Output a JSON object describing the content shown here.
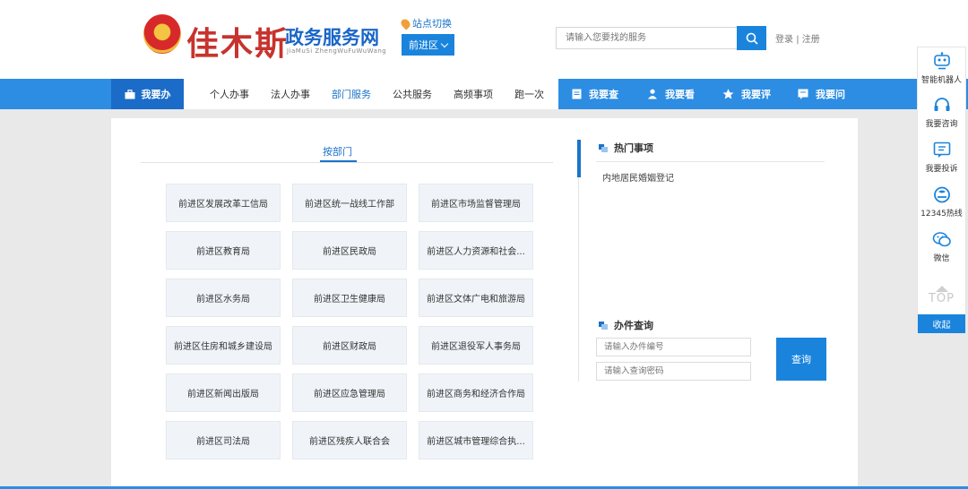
{
  "header": {
    "logo_text": "佳木斯",
    "site_title": "政务服务网",
    "pinyin": "JiaMuSi ZhengWuFuWuWang",
    "site_switch_label": "站点切换",
    "district": "前进区",
    "search_placeholder": "请输入您要找的服务",
    "login": "登录",
    "separator": "|",
    "register": "注册"
  },
  "nav": {
    "main": "我要办",
    "links": [
      "个人办事",
      "法人办事",
      "部门服务",
      "公共服务",
      "高频事项",
      "跑一次"
    ],
    "active_index": 2,
    "right": [
      "我要查",
      "我要看",
      "我要评",
      "我要问"
    ]
  },
  "departments": {
    "tab": "按部门",
    "items": [
      "前进区发展改革工信局",
      "前进区统一战线工作部",
      "前进区市场监督管理局",
      "前进区教育局",
      "前进区民政局",
      "前进区人力资源和社会...",
      "前进区水务局",
      "前进区卫生健康局",
      "前进区文体广电和旅游局",
      "前进区住房和城乡建设局",
      "前进区财政局",
      "前进区退役军人事务局",
      "前进区新闻出版局",
      "前进区应急管理局",
      "前进区商务和经济合作局",
      "前进区司法局",
      "前进区残疾人联合会",
      "前进区城市管理综合执..."
    ]
  },
  "hot": {
    "title": "热门事项",
    "items": [
      "内地居民婚姻登记"
    ]
  },
  "query": {
    "title": "办件查询",
    "number_placeholder": "请输入办件编号",
    "password_placeholder": "请输入查询密码",
    "button": "查询"
  },
  "float_bar": {
    "items": [
      "智能机器人",
      "我要咨询",
      "我要投诉",
      "12345热线",
      "微信"
    ],
    "top": "TOP",
    "collapse": "收起"
  },
  "colors": {
    "primary": "#1a84dd",
    "nav_bar": "#2c8de3",
    "nav_main": "#1a6cc8",
    "logo_red": "#c7332d"
  }
}
